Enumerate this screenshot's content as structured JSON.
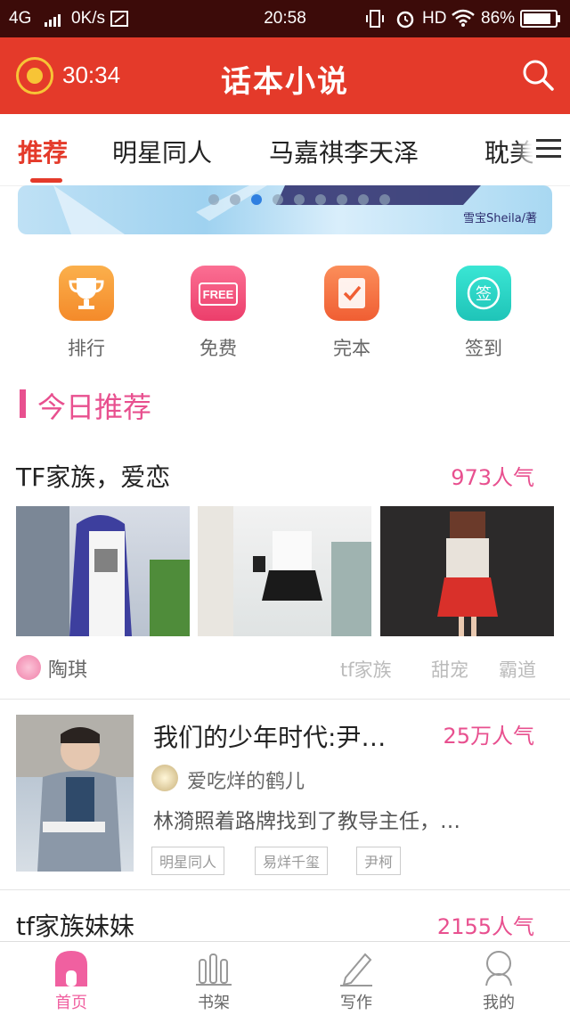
{
  "status_bar": {
    "network": "4G",
    "speed": "0K/s",
    "time": "20:58",
    "hd": "HD",
    "battery": "86%"
  },
  "header": {
    "timer": "30:34",
    "title": "话本小说"
  },
  "tabs": [
    {
      "label": "推荐",
      "active": true
    },
    {
      "label": "明星同人",
      "active": false
    },
    {
      "label": "马嘉祺李天泽",
      "active": false
    },
    {
      "label": "耽美",
      "active": false
    }
  ],
  "banner": {
    "credit": "雪宝Sheila/著",
    "dot_count": 9,
    "active_dot": 2
  },
  "quick_actions": [
    {
      "label": "排行",
      "icon": "trophy-icon",
      "color": "#f79a3a"
    },
    {
      "label": "免费",
      "icon": "free-tag-icon",
      "color": "#f2507a",
      "icon_text": "FREE"
    },
    {
      "label": "完本",
      "icon": "check-book-icon",
      "color": "#f47a4a"
    },
    {
      "label": "签到",
      "icon": "sign-in-icon",
      "color": "#2fd6c8",
      "icon_text": "签"
    }
  ],
  "section": {
    "title": "今日推荐"
  },
  "feed": [
    {
      "title": "TF家族，爱恋",
      "popularity": "973人气",
      "author": "陶琪",
      "tags": [
        "tf家族",
        "甜宠",
        "霸道"
      ]
    },
    {
      "title": "我们的少年时代:尹…",
      "popularity": "25万人气",
      "author": "爱吃烊的鹤儿",
      "summary": "林漪照着路牌找到了教导主任，…",
      "tags": [
        "明星同人",
        "易烊千玺",
        "尹柯"
      ]
    },
    {
      "title": "tf家族妹妹",
      "popularity": "2155人气"
    }
  ],
  "bottom_nav": [
    {
      "label": "首页",
      "icon": "home-icon",
      "active": true
    },
    {
      "label": "书架",
      "icon": "bookshelf-icon",
      "active": false
    },
    {
      "label": "写作",
      "icon": "pen-icon",
      "active": false
    },
    {
      "label": "我的",
      "icon": "profile-icon",
      "active": false
    }
  ],
  "colors": {
    "brand_red": "#e43a2a",
    "accent_pink": "#e8508f",
    "status_bg": "#3c0b09"
  }
}
